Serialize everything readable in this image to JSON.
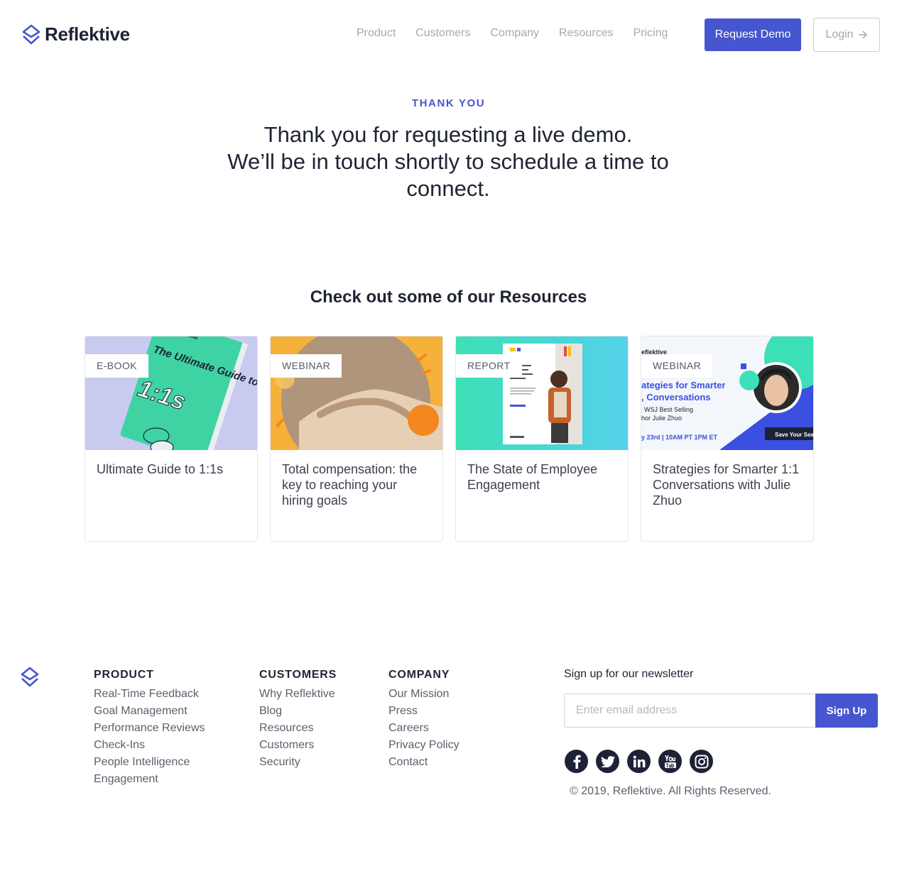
{
  "header": {
    "brand": "Reflektive",
    "nav": [
      "Product",
      "Customers",
      "Company",
      "Resources",
      "Pricing"
    ],
    "request_demo": "Request Demo",
    "login": "Login"
  },
  "hero": {
    "eyebrow": "THANK YOU",
    "line1": "Thank you for requesting a live demo.",
    "line2": "We’ll be in touch shortly to schedule a time to",
    "line3": "connect."
  },
  "resources": {
    "heading": "Check out some of our Resources",
    "cards": [
      {
        "tag": "E-BOOK",
        "title": "Ultimate Guide to 1:1s"
      },
      {
        "tag": "WEBINAR",
        "title": "Total compensation: the key to reaching your hiring goals"
      },
      {
        "tag": "REPORT",
        "title": "The State of Employee Engagement"
      },
      {
        "tag": "WEBINAR",
        "title": "Strategies for Smarter 1:1 Conversations with Julie Zhuo"
      }
    ],
    "thumb_text": {
      "ebook": "The Ultimate Guide to",
      "ebook_big": "1:1s",
      "webinar2_line1": "ategies for Smarter",
      "webinar2_line2": ", Conversations",
      "webinar2_line3": "WSJ Best Selling",
      "webinar2_line4": "hor Julie Zhuo",
      "webinar2_date": "y 23rd | 10AM PT 1PM ET",
      "webinar2_cta": "Save Your Seat",
      "webinar2_brand": "eflektive"
    }
  },
  "footer": {
    "columns": [
      {
        "heading": "PRODUCT",
        "links": [
          "Real-Time Feedback",
          "Goal Management",
          "Performance Reviews",
          "Check-Ins",
          "People Intelligence",
          "Engagement"
        ]
      },
      {
        "heading": "CUSTOMERS",
        "links": [
          "Why Reflektive",
          "Blog",
          "Resources",
          "Customers",
          "Security"
        ]
      },
      {
        "heading": "COMPANY",
        "links": [
          "Our Mission",
          "Press",
          "Careers",
          "Privacy Policy",
          "Contact"
        ]
      }
    ],
    "newsletter_label": "Sign up for our newsletter",
    "email_placeholder": "Enter email address",
    "signup": "Sign Up",
    "socials": [
      "facebook-icon",
      "twitter-icon",
      "linkedin-icon",
      "youtube-icon",
      "instagram-icon"
    ],
    "copyright": "© 2019, Reflektive. All Rights Reserved."
  },
  "colors": {
    "accent": "#4655d0",
    "text": "#1f2433",
    "muted": "#a6a9b2"
  }
}
